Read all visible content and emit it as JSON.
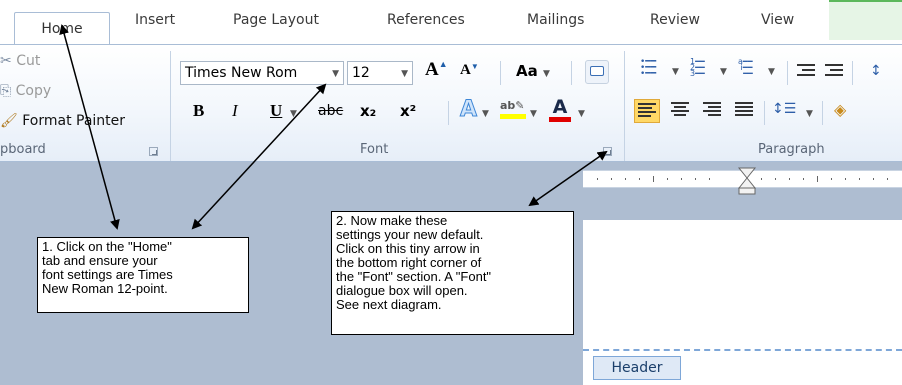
{
  "tabs": [
    {
      "label": "Home",
      "active": true
    },
    {
      "label": "Insert"
    },
    {
      "label": "Page Layout"
    },
    {
      "label": "References"
    },
    {
      "label": "Mailings"
    },
    {
      "label": "Review"
    },
    {
      "label": "View"
    }
  ],
  "clipboard": {
    "cut": "Cut",
    "copy": "Copy",
    "format_painter": "Format Painter",
    "label": "pboard"
  },
  "font": {
    "name": "Times New Rom",
    "size": "12",
    "label": "Font",
    "bold": "B",
    "italic": "I",
    "underline": "U",
    "strike": "abc",
    "subscript": "x₂",
    "superscript": "x²",
    "grow": "A",
    "shrink": "A",
    "case": "Aa",
    "color_bar": "#e00000",
    "highlight_bar": "#ffff00"
  },
  "paragraph": {
    "label": "Paragraph"
  },
  "document": {
    "header_tag": "Header"
  },
  "callouts": {
    "one": "1. Click on the \"Home\"\ntab and ensure your\nfont settings are Times\nNew Roman 12-point.",
    "two": "2. Now make these\nsettings your new default.\nClick on this tiny arrow in\nthe bottom right corner of\nthe \"Font\" section. A \"Font\"\ndialogue box will open.\nSee next diagram."
  },
  "colors": {
    "accent": "#a9bdd6",
    "selected": "#ffd866"
  }
}
